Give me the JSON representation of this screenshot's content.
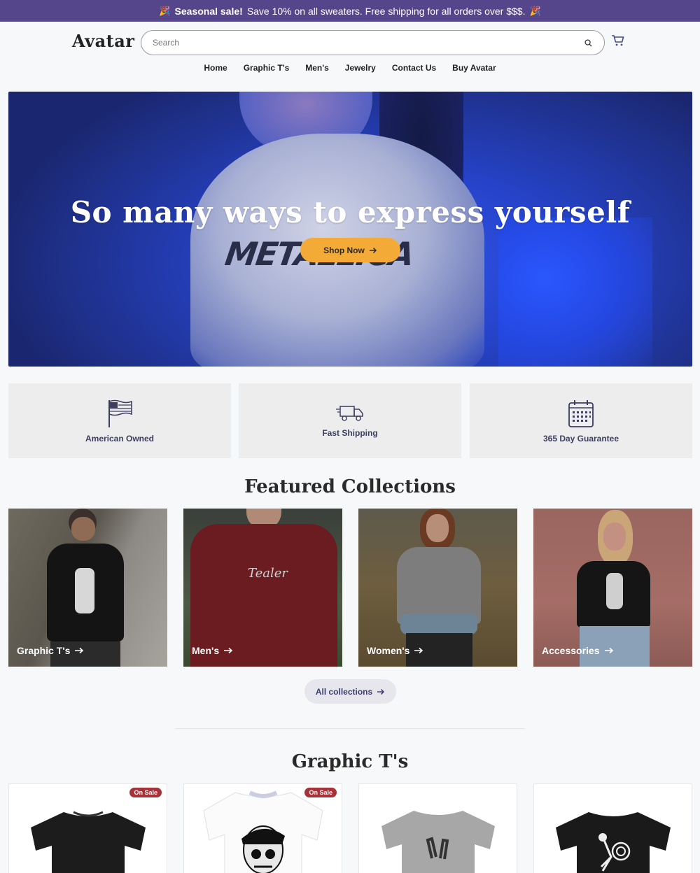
{
  "announcement": {
    "emoji": "🎉",
    "bold": "Seasonal sale!",
    "text": "Save 10% on all sweaters. Free shipping for all orders over $$$."
  },
  "header": {
    "logo": "Avatar",
    "search_placeholder": "Search"
  },
  "nav": [
    "Home",
    "Graphic T's",
    "Men's",
    "Jewelry",
    "Contact Us",
    "Buy Avatar"
  ],
  "hero": {
    "heading": "So many ways to express yourself",
    "shirt_print": "METALLICA",
    "button": "Shop Now"
  },
  "features": [
    {
      "label": "American Owned",
      "icon": "flag-icon"
    },
    {
      "label": "Fast Shipping",
      "icon": "truck-icon"
    },
    {
      "label": "365 Day Guarantee",
      "icon": "calendar-icon"
    }
  ],
  "featured": {
    "title": "Featured Collections",
    "collections": [
      "Graphic T's",
      "Men's",
      "Women's",
      "Accessories"
    ],
    "all_button": "All collections"
  },
  "graphic_tees": {
    "title": "Graphic T's",
    "badges": [
      "On Sale",
      "On Sale"
    ]
  },
  "colors": {
    "accent": "#55468c",
    "cta": "#f3aa37",
    "sale": "#a8323a"
  }
}
